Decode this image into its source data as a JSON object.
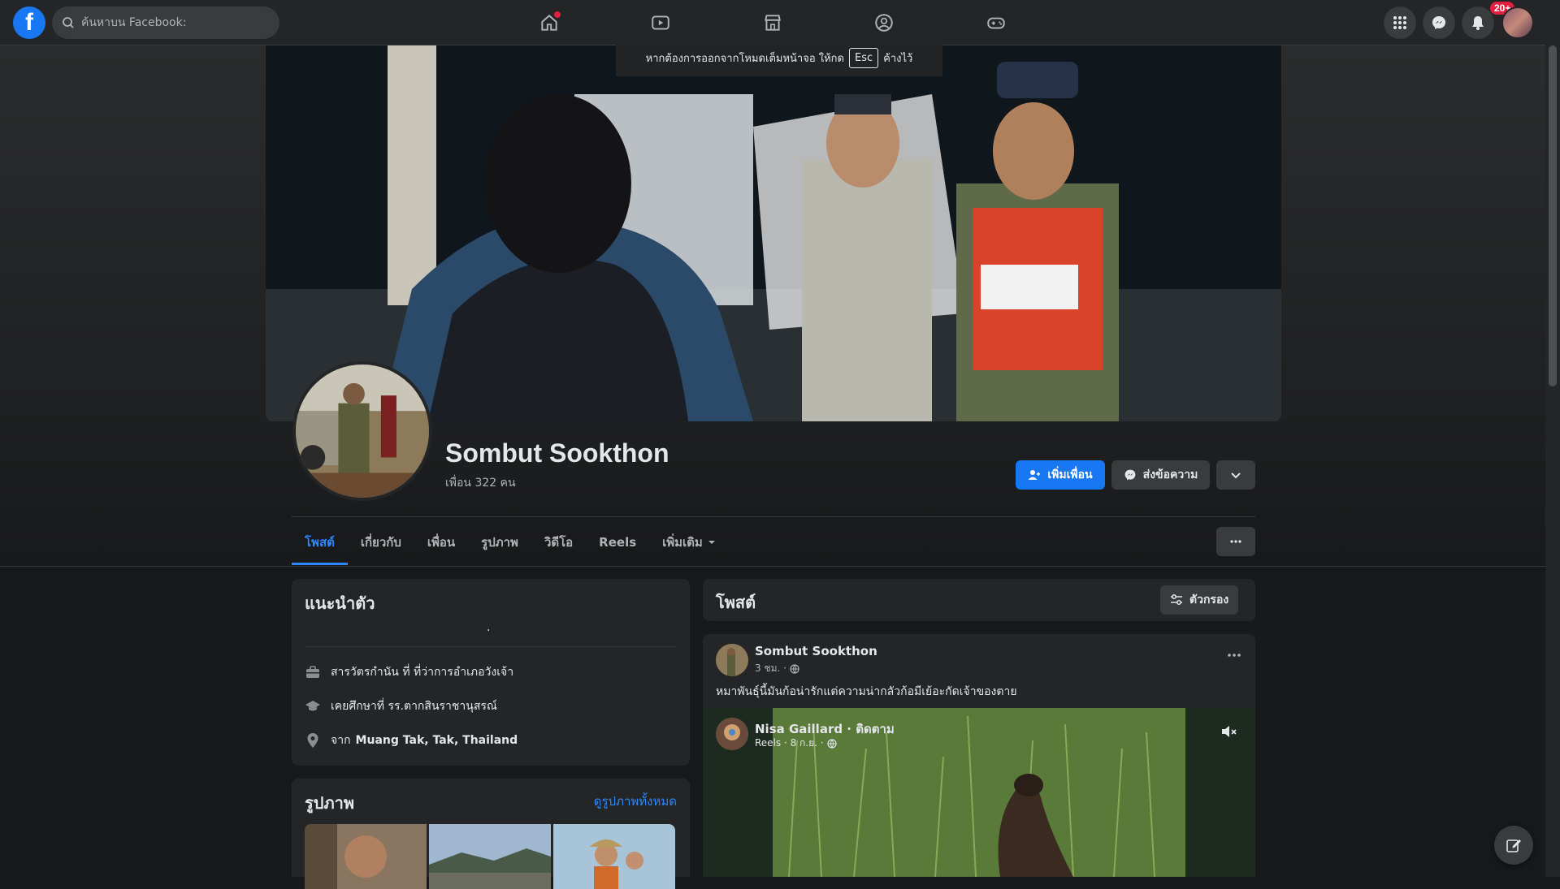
{
  "topbar": {
    "logo_letter": "f",
    "search_placeholder": "ค้นหาบน Facebook:",
    "notification_badge": "20+"
  },
  "fullscreen_notice": {
    "before": "หากต้องการออกจากโหมดเต็มหน้าจอ ให้กด",
    "key": "Esc",
    "after": "ค้างไว้"
  },
  "profile": {
    "name": "Sombut Sookthon",
    "friends": "เพื่อน 322 คน",
    "add_friend_label": "เพิ่มเพื่อน",
    "message_label": "ส่งข้อความ"
  },
  "tabs": [
    {
      "label": "โพสต์"
    },
    {
      "label": "เกี่ยวกับ"
    },
    {
      "label": "เพื่อน"
    },
    {
      "label": "รูปภาพ"
    },
    {
      "label": "วิดีโอ"
    },
    {
      "label": "Reels"
    },
    {
      "label": "เพิ่มเติม"
    }
  ],
  "intro": {
    "title": "แนะนำตัว",
    "dot": ".",
    "work": "สารวัตรกำนัน ที่ ที่ว่าการอำเภอวังเจ้า",
    "education": "เคยศึกษาที่ รร.ตากสินราชานุสรณ์",
    "from_prefix": "จาก",
    "from_place": "Muang Tak, Tak, Thailand"
  },
  "photos": {
    "title": "รูปภาพ",
    "see_all": "ดูรูปภาพทั้งหมด"
  },
  "posts": {
    "title": "โพสต์",
    "filter_label": "ตัวกรอง",
    "post1": {
      "author": "Sombut Sookthon",
      "time": "3 ชม. ·",
      "text": "หมาพันธุ์นี้มันก้อน่ารักแต่ความน่ากลัวก้อมีเย้อะกัดเจ้าของตาย"
    },
    "shared_reel": {
      "author": "Nisa Gaillard · ติดตาม",
      "meta": "Reels · 8 ก.ย. ·"
    }
  },
  "colors": {
    "accent": "#1877f2",
    "link": "#2d88ff",
    "background": "#18191a",
    "surface": "#242526"
  }
}
